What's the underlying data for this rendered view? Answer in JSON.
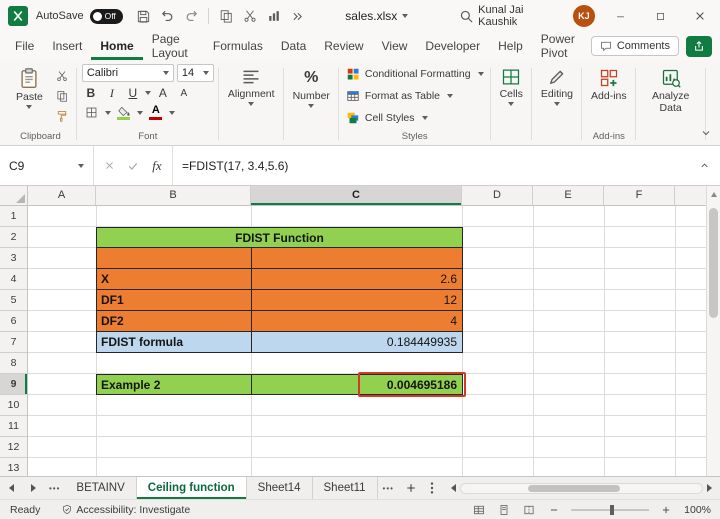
{
  "titlebar": {
    "autosave_label": "AutoSave",
    "autosave_state": "Off",
    "filename": "sales.xlsx",
    "user_name": "Kunal Jai Kaushik",
    "user_initials": "KJ"
  },
  "menubar": {
    "tabs": [
      "File",
      "Insert",
      "Home",
      "Page Layout",
      "Formulas",
      "Data",
      "Review",
      "View",
      "Developer",
      "Help",
      "Power Pivot"
    ],
    "active_tab": "Home",
    "comments_label": "Comments"
  },
  "ribbon": {
    "paste_label": "Paste",
    "clipboard_group": "Clipboard",
    "font_group": "Font",
    "styles_group": "Styles",
    "addins_group": "Add-ins",
    "font_name": "Calibri",
    "font_size": "14",
    "font_controls": {
      "bold": "B",
      "italic": "I",
      "underline": "U",
      "grow": "A",
      "shrink": "A",
      "color": "A"
    },
    "number_icon": "%",
    "alignment_label": "Alignment",
    "number_label": "Number",
    "conditional_formatting": "Conditional Formatting",
    "format_as_table": "Format as Table",
    "cell_styles": "Cell Styles",
    "cells_label": "Cells",
    "editing_label": "Editing",
    "addins_label": "Add-ins",
    "analyze_data_label": "Analyze Data"
  },
  "formula_bar": {
    "name_box": "C9",
    "fx_label": "fx",
    "formula": "=FDIST(17, 3.4,5.6)"
  },
  "sheet": {
    "column_headers": [
      "A",
      "B",
      "C",
      "D",
      "E",
      "F"
    ],
    "row_headers": [
      "1",
      "2",
      "3",
      "4",
      "5",
      "6",
      "7",
      "8",
      "9",
      "10",
      "11",
      "12",
      "13"
    ],
    "selected_column": "C",
    "selected_row": "9",
    "cells": {
      "title": "FDIST Function",
      "x_label": "X",
      "x_value": "2.6",
      "df1_label": "DF1",
      "df1_value": "12",
      "df2_label": "DF2",
      "df2_value": "4",
      "fdist_label": "FDIST formula",
      "fdist_value": "0.184449935",
      "example_label": "Example 2",
      "example_value": "0.004695186"
    },
    "colors": {
      "header_green": "#92D050",
      "input_orange": "#ED7D31",
      "result_blue": "#BDD7EE",
      "highlight_red": "#D13A26",
      "accent_green": "#107C41"
    }
  },
  "sheet_tabs": {
    "tabs": [
      "BETAINV",
      "Ceiling function",
      "Sheet14",
      "Sheet11"
    ],
    "active_tab": "Ceiling function",
    "overflow_dots": "•••"
  },
  "status_bar": {
    "ready_label": "Ready",
    "accessibility_label": "Accessibility: Investigate",
    "zoom_level": "100%"
  }
}
